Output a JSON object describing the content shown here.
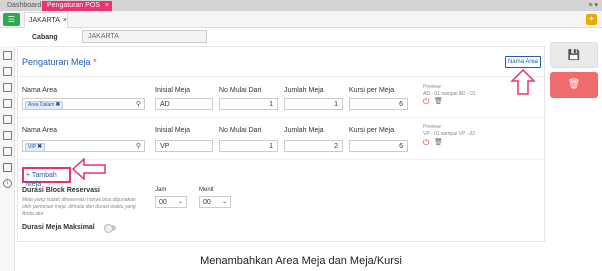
{
  "tabs": [
    {
      "label": "Dashboard"
    },
    {
      "label": "Pengaturan POS",
      "close": "×"
    }
  ],
  "tab_menu": "≡ ▾",
  "location_tab": {
    "label": "JAKARTA",
    "close": "×"
  },
  "cabang": {
    "label": "Cabang",
    "value": "JAKARTA"
  },
  "panel": {
    "title": "Pengaturan Meja",
    "required_mark": "*",
    "nama_area_button": "Nama Area",
    "columns": {
      "nama_area": "Nama Area",
      "inisial_meja": "Inisial Meja",
      "no_mulai_dari": "No Mulai Dari",
      "jumlah_meja": "Jumlah Meja",
      "kursi_per_meja": "Kursi per Meja"
    },
    "rows": [
      {
        "area_chip": "Area Dalam",
        "inisial": "AD",
        "no_mulai": "1",
        "jumlah": "1",
        "kursi": "6",
        "preview_label": "Preview",
        "preview_text": "AD - 01 sampai AD - 01"
      },
      {
        "area_chip": "VIP",
        "inisial": "VP",
        "no_mulai": "1",
        "jumlah": "2",
        "kursi": "6",
        "preview_label": "Preview",
        "preview_text": "VP - 01 sampai VP - 02"
      }
    ],
    "tambah_meja": "+ Tambah Meja",
    "durasi_block": {
      "title": "Durasi Block Reservasi",
      "description": "Meja yang sudah direservasi hanya bisa digunakan oleh pemesan meja, dimulai dari durasi waktu yang Anda atur",
      "jam_label": "Jam",
      "jam_value": "00",
      "menit_label": "Menit",
      "menit_value": "00"
    },
    "durasi_maksimal": {
      "title": "Durasi Meja Maksimal",
      "enabled": false
    }
  },
  "caption": "Menambahkan Area Meja dan Meja/Kursi",
  "colors": {
    "accent_pink": "#e8336e",
    "primary_blue": "#1f5fae",
    "menu_green": "#2fa84f",
    "delete_red": "#f06b6b",
    "bulb_orange": "#f0a800"
  },
  "icons": {
    "menu": "list-icon",
    "bulb": "lightbulb-icon",
    "search": "search-icon",
    "power": "power-icon",
    "trash": "trash-icon",
    "save": "floppy-disk-icon",
    "delete": "trash-icon"
  }
}
